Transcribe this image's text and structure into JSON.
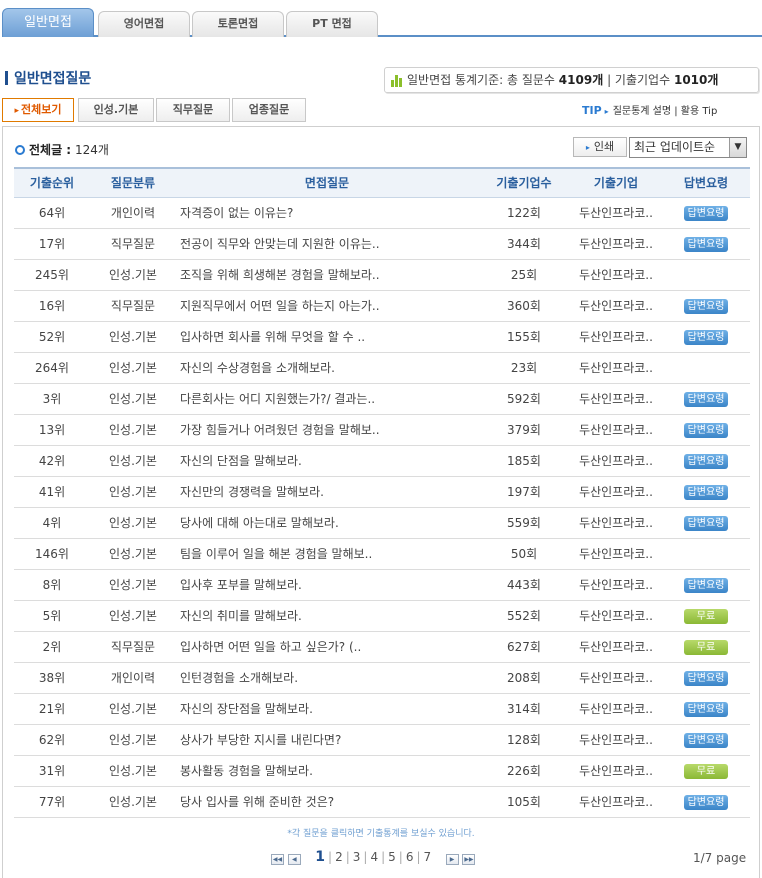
{
  "tabs": [
    "일반면접",
    "영어면접",
    "토론면접",
    "PT 면접"
  ],
  "section_title": "일반면접질문",
  "stats": {
    "prefix": "일반면접 통계기준: 총 질문수",
    "question_count": "4109개",
    "mid": "| 기출기업수",
    "company_count": "1010개"
  },
  "subtabs": [
    "전체보기",
    "인성.기본",
    "직무질문",
    "업종질문"
  ],
  "tip": {
    "label": "TIP",
    "text": "질문통계 설명 | 활용 Tip"
  },
  "total": {
    "label": "전체글 :",
    "count": "124개"
  },
  "print_label": "인쇄",
  "sort_value": "최근 업데이트순",
  "columns": [
    "기출순위",
    "질문분류",
    "면접질문",
    "기출기업수",
    "기출기업",
    "답변요령"
  ],
  "rows": [
    {
      "rank": "64위",
      "cat": "개인이력",
      "q": "자격증이 없는 이유는?",
      "count": "122회",
      "company": "두산인프라코..",
      "badge": "답변요령",
      "color": "blue"
    },
    {
      "rank": "17위",
      "cat": "직무질문",
      "q": "전공이 직무와 안맞는데 지원한 이유는..",
      "count": "344회",
      "company": "두산인프라코..",
      "badge": "답변요령",
      "color": "blue"
    },
    {
      "rank": "245위",
      "cat": "인성.기본",
      "q": "조직을 위해 희생해본 경험을 말해보라..",
      "count": "25회",
      "company": "두산인프라코..",
      "badge": "",
      "color": ""
    },
    {
      "rank": "16위",
      "cat": "직무질문",
      "q": "지원직무에서 어떤 일을 하는지 아는가..",
      "count": "360회",
      "company": "두산인프라코..",
      "badge": "답변요령",
      "color": "blue"
    },
    {
      "rank": "52위",
      "cat": "인성.기본",
      "q": "입사하면 회사를 위해 무엇을 할 수 ..",
      "count": "155회",
      "company": "두산인프라코..",
      "badge": "답변요령",
      "color": "blue"
    },
    {
      "rank": "264위",
      "cat": "인성.기본",
      "q": "자신의 수상경험을 소개해보라.",
      "count": "23회",
      "company": "두산인프라코..",
      "badge": "",
      "color": ""
    },
    {
      "rank": "3위",
      "cat": "인성.기본",
      "q": "다른회사는 어디 지원했는가?/ 결과는..",
      "count": "592회",
      "company": "두산인프라코..",
      "badge": "답변요령",
      "color": "blue"
    },
    {
      "rank": "13위",
      "cat": "인성.기본",
      "q": "가장 힘들거나 어려웠던 경험을 말해보..",
      "count": "379회",
      "company": "두산인프라코..",
      "badge": "답변요령",
      "color": "blue"
    },
    {
      "rank": "42위",
      "cat": "인성.기본",
      "q": "자신의 단점을 말해보라.",
      "count": "185회",
      "company": "두산인프라코..",
      "badge": "답변요령",
      "color": "blue"
    },
    {
      "rank": "41위",
      "cat": "인성.기본",
      "q": "자신만의 경쟁력을 말해보라.",
      "count": "197회",
      "company": "두산인프라코..",
      "badge": "답변요령",
      "color": "blue"
    },
    {
      "rank": "4위",
      "cat": "인성.기본",
      "q": "당사에 대해 아는대로 말해보라.",
      "count": "559회",
      "company": "두산인프라코..",
      "badge": "답변요령",
      "color": "blue"
    },
    {
      "rank": "146위",
      "cat": "인성.기본",
      "q": "팀을 이루어 일을 해본 경험을 말해보..",
      "count": "50회",
      "company": "두산인프라코..",
      "badge": "",
      "color": ""
    },
    {
      "rank": "8위",
      "cat": "인성.기본",
      "q": "입사후 포부를 말해보라.",
      "count": "443회",
      "company": "두산인프라코..",
      "badge": "답변요령",
      "color": "blue"
    },
    {
      "rank": "5위",
      "cat": "인성.기본",
      "q": "자신의 취미를 말해보라.",
      "count": "552회",
      "company": "두산인프라코..",
      "badge": "무료",
      "color": "green"
    },
    {
      "rank": "2위",
      "cat": "직무질문",
      "q": "입사하면 어떤 일을 하고 싶은가? (..",
      "count": "627회",
      "company": "두산인프라코..",
      "badge": "무료",
      "color": "green"
    },
    {
      "rank": "38위",
      "cat": "개인이력",
      "q": "인턴경험을 소개해보라.",
      "count": "208회",
      "company": "두산인프라코..",
      "badge": "답변요령",
      "color": "blue"
    },
    {
      "rank": "21위",
      "cat": "인성.기본",
      "q": "자신의 장단점을 말해보라.",
      "count": "314회",
      "company": "두산인프라코..",
      "badge": "답변요령",
      "color": "blue"
    },
    {
      "rank": "62위",
      "cat": "인성.기본",
      "q": "상사가 부당한 지시를 내린다면?",
      "count": "128회",
      "company": "두산인프라코..",
      "badge": "답변요령",
      "color": "blue"
    },
    {
      "rank": "31위",
      "cat": "인성.기본",
      "q": "봉사활동 경험을 말해보라.",
      "count": "226회",
      "company": "두산인프라코..",
      "badge": "무료",
      "color": "green"
    },
    {
      "rank": "77위",
      "cat": "인성.기본",
      "q": "당사 입사를 위해 준비한 것은?",
      "count": "105회",
      "company": "두산인프라코..",
      "badge": "답변요령",
      "color": "blue"
    }
  ],
  "note": "*각 질문을 클릭하면 기출통계를 보실수 있습니다.",
  "pager": {
    "pages": [
      "1",
      "2",
      "3",
      "4",
      "5",
      "6",
      "7"
    ],
    "current": "1",
    "info": "1/7 page"
  }
}
